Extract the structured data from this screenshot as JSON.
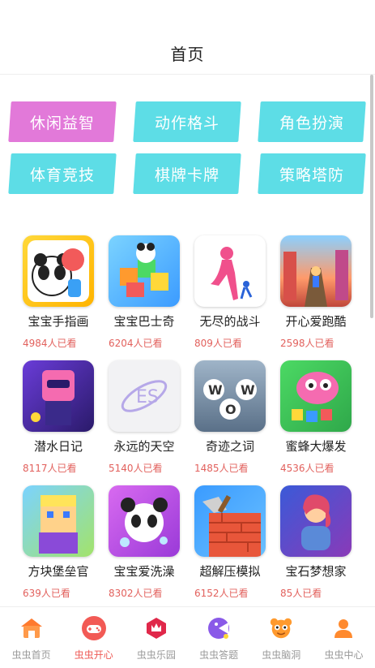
{
  "header": {
    "title": "首页"
  },
  "categories": [
    {
      "label": "休闲益智",
      "color": "#e279d9"
    },
    {
      "label": "动作格斗",
      "color": "#5ddde6"
    },
    {
      "label": "角色扮演",
      "color": "#5ddde6"
    },
    {
      "label": "体育竞技",
      "color": "#5ddde6"
    },
    {
      "label": "棋牌卡牌",
      "color": "#5ddde6"
    },
    {
      "label": "策略塔防",
      "color": "#5ddde6"
    }
  ],
  "games": [
    {
      "name": "宝宝手指画",
      "views": "4984人已看"
    },
    {
      "name": "宝宝巴士奇",
      "views": "6204人已看"
    },
    {
      "name": "无尽的战斗",
      "views": "809人已看"
    },
    {
      "name": "开心爱跑酷",
      "views": "2598人已看"
    },
    {
      "name": "潜水日记",
      "views": "8117人已看"
    },
    {
      "name": "永远的天空",
      "views": "5140人已看"
    },
    {
      "name": "奇迹之词",
      "views": "1485人已看"
    },
    {
      "name": "蜜蜂大爆发",
      "views": "4536人已看"
    },
    {
      "name": "方块堡垒官",
      "views": "639人已看"
    },
    {
      "name": "宝宝爱洗澡",
      "views": "8302人已看"
    },
    {
      "name": "超解压模拟",
      "views": "6152人已看"
    },
    {
      "name": "宝石梦想家",
      "views": "85人已看"
    }
  ],
  "tabbar": {
    "items": [
      {
        "label": "虫虫首页",
        "icon": "home-icon"
      },
      {
        "label": "虫虫开心",
        "icon": "gamepad-icon",
        "active": true
      },
      {
        "label": "虫虫乐园",
        "icon": "crown-icon"
      },
      {
        "label": "虫虫答题",
        "icon": "quiz-icon"
      },
      {
        "label": "虫虫脑洞",
        "icon": "mascot-icon"
      },
      {
        "label": "虫虫中心",
        "icon": "user-icon"
      }
    ],
    "active_color": "#ee5a55",
    "inactive_color": "#999999"
  }
}
